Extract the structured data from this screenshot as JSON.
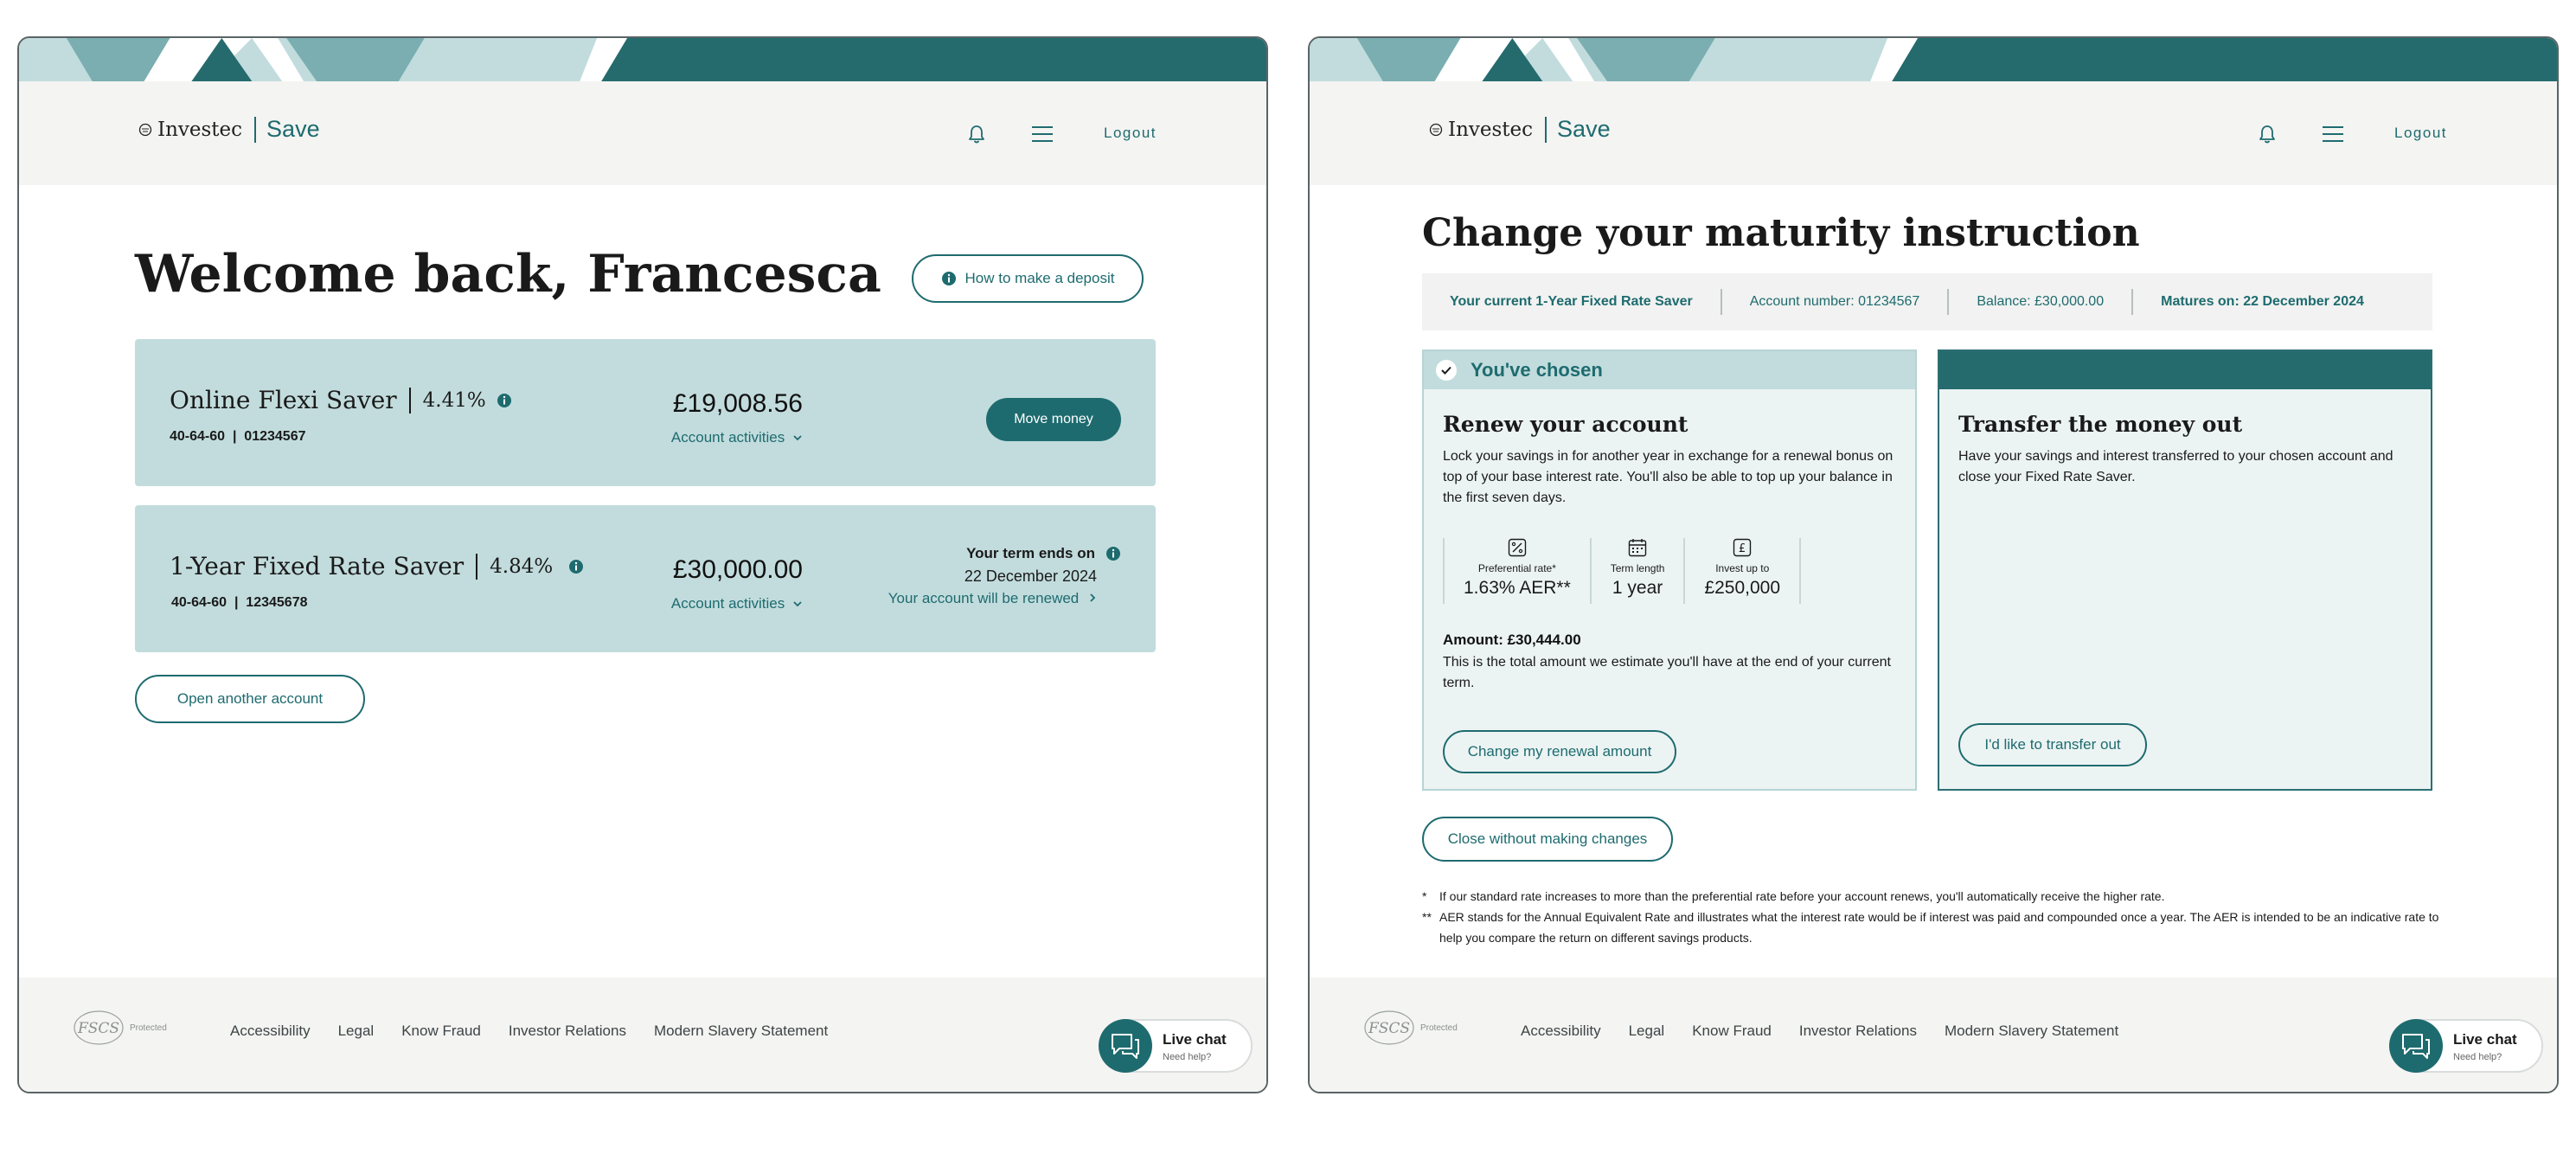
{
  "colors": {
    "brand_teal": "#1e6b6f",
    "card_teal": "#c2dcdd",
    "panel_bg": "#ecf4f3",
    "header_bg": "#f4f4f2",
    "banner_light": "#c2dcdd",
    "banner_mid": "#7aaeb0",
    "banner_dark": "#256b6e"
  },
  "header": {
    "brand": "Investec",
    "product": "Save",
    "logout_label": "Logout",
    "icons": [
      "bell-icon",
      "menu-icon"
    ]
  },
  "footer": {
    "fscs_label": "FSCS",
    "fscs_protected": "Protected",
    "links": [
      "Accessibility",
      "Legal",
      "Know Fraud",
      "Investor Relations",
      "Modern Slavery Statement"
    ],
    "livechat_title": "Live chat",
    "livechat_sub": "Need help?"
  },
  "dashboard": {
    "welcome": "Welcome back, Francesca",
    "deposit_button": "How to make a deposit",
    "accounts": [
      {
        "name": "Online Flexi Saver",
        "rate": "4.41%",
        "sort_account": "40-64-60  |  01234567",
        "balance": "£19,008.56",
        "activities_label": "Account activities",
        "action_label": "Move money"
      },
      {
        "name": "1-Year Fixed Rate Saver",
        "rate": "4.84%",
        "sort_account": "40-64-60  |  12345678",
        "balance": "£30,000.00",
        "activities_label": "Account activities",
        "term_ends_label": "Your term ends on",
        "term_date": "22 December 2024",
        "renew_label": "Your account will be renewed"
      }
    ],
    "open_account_button": "Open another account"
  },
  "maturity": {
    "title": "Change your maturity instruction",
    "strip": {
      "current": "Your current 1-Year Fixed Rate Saver",
      "account_number": "Account number: 01234567",
      "balance": "Balance: £30,000.00",
      "matures": "Matures on: 22 December 2024"
    },
    "renew": {
      "chosen_label": "You've chosen",
      "title": "Renew your account",
      "description": "Lock your savings in for another year in exchange for a renewal bonus on top of your base interest rate. You'll also be able to top up your balance in the first seven days.",
      "stats": [
        {
          "icon": "percent-icon",
          "label": "Preferential rate*",
          "value": "1.63% AER**"
        },
        {
          "icon": "calendar-icon",
          "label": "Term length",
          "value": "1 year"
        },
        {
          "icon": "pound-icon",
          "label": "Invest up to",
          "value": "£250,000"
        }
      ],
      "amount_title": "Amount: £30,444.00",
      "amount_desc": "This is the total amount we estimate you'll have at the end of your current term.",
      "button": "Change my renewal amount"
    },
    "transfer": {
      "title": "Transfer the money out",
      "description": "Have your savings and interest transferred to your chosen account and close your Fixed Rate Saver.",
      "button": "I'd like to transfer out"
    },
    "close_button": "Close without making changes",
    "notes": [
      {
        "mark": "*",
        "text": "If our standard rate increases to more than the preferential rate before your account renews, you'll automatically receive the higher rate."
      },
      {
        "mark": "**",
        "text": "AER stands for the Annual Equivalent Rate and illustrates what the interest rate would be if interest was paid and compounded once a year. The AER is intended to be an indicative rate to help you compare the return on different savings products."
      }
    ]
  }
}
